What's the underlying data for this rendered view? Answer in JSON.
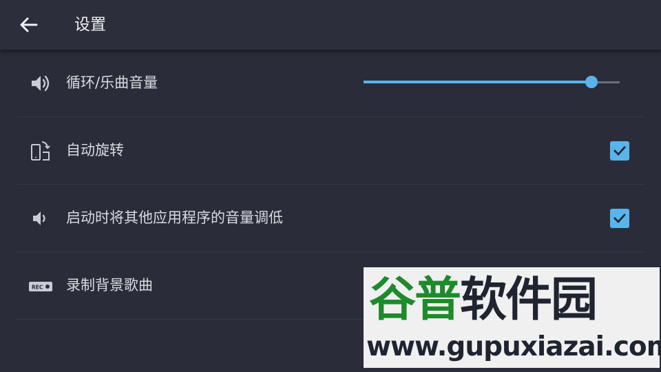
{
  "header": {
    "title": "设置",
    "back_icon": "arrow-left-icon"
  },
  "settings": [
    {
      "icon": "volume-icon",
      "label": "循环/乐曲音量",
      "control": "slider",
      "value": 0.89
    },
    {
      "icon": "screen-rotation-icon",
      "label": "自动旋转",
      "control": "checkbox",
      "checked": true
    },
    {
      "icon": "volume-low-icon",
      "label": "启动时将其他应用程序的音量调低",
      "control": "checkbox",
      "checked": true
    },
    {
      "icon": "rec-icon",
      "label": "录制背景歌曲",
      "control": "none"
    }
  ],
  "watermark": {
    "brand_green": "谷普",
    "brand_dark": "软件园",
    "url": "www.gupuxiazai.com"
  },
  "colors": {
    "background": "#2a2d39",
    "accent": "#5ab4ec",
    "watermark_green": "#1e8a2c"
  }
}
